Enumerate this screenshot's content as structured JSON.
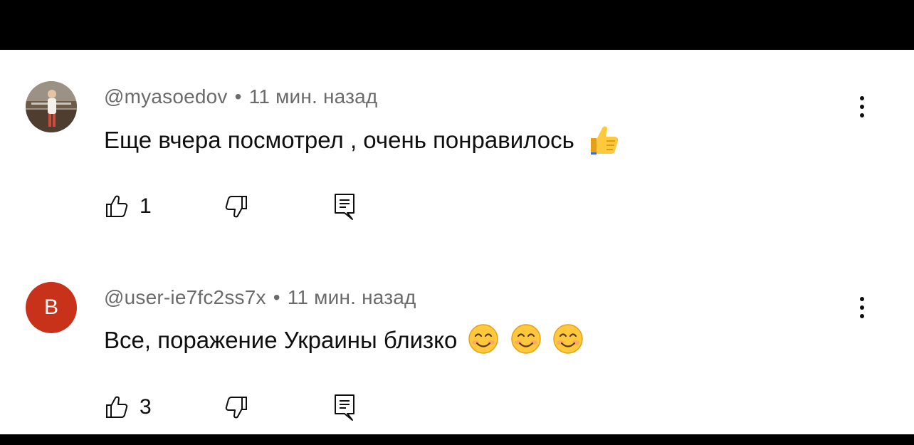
{
  "comments": [
    {
      "author": "@myasoedov",
      "separator": "•",
      "time": "11 мин. назад",
      "text": "Еще вчера посмотрел , очень понравилось",
      "emojis": [
        "thumbs-up"
      ],
      "likes": "1",
      "avatar_type": "photo"
    },
    {
      "author": "@user-ie7fc2ss7x",
      "separator": "•",
      "time": "11 мин. назад",
      "text": "Все, поражение Украины близко",
      "emojis": [
        "smiling-face",
        "smiling-face",
        "smiling-face"
      ],
      "likes": "3",
      "avatar_type": "letter",
      "avatar_letter": "B"
    }
  ],
  "icons": {
    "like": "thumbs-up-outline-icon",
    "dislike": "thumbs-down-outline-icon",
    "reply": "reply-comment-icon",
    "more": "more-vertical-icon"
  },
  "colors": {
    "background": "#000000",
    "panel": "#ffffff",
    "meta_text": "#6b6b6b",
    "body_text": "#0f0f0f",
    "letter_avatar": "#c8321b"
  }
}
